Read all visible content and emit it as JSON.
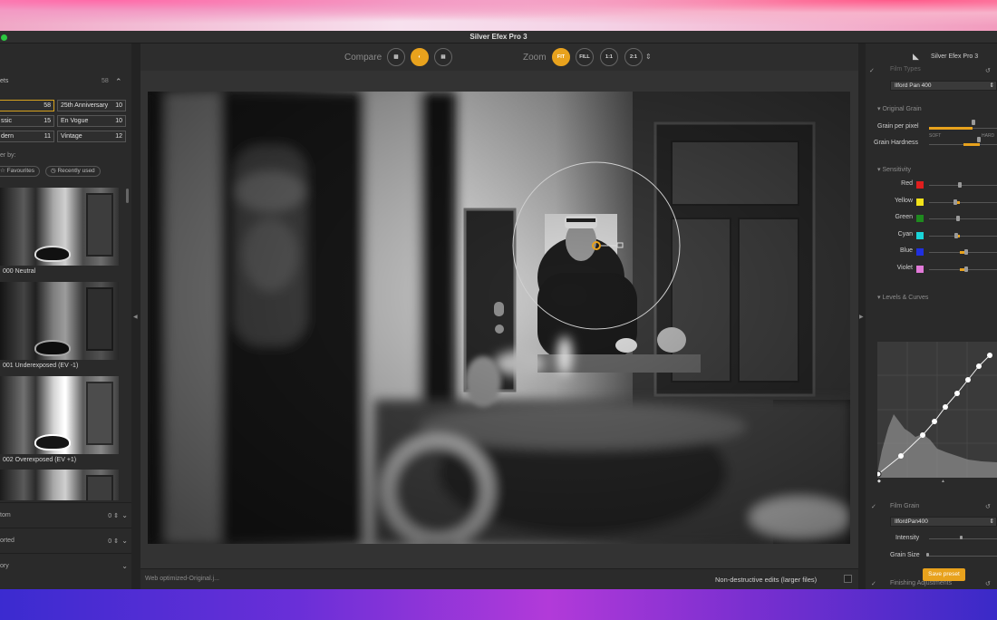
{
  "window": {
    "title": "Silver Efex Pro 3"
  },
  "left_panel": {
    "header": "ets",
    "header_count": "58",
    "presets": [
      {
        "label": "",
        "count": "58",
        "active": true
      },
      {
        "label": "25th Anniversary",
        "count": "10"
      },
      {
        "label": "ssic",
        "count": "15"
      },
      {
        "label": "En Vogue",
        "count": "10"
      },
      {
        "label": "dern",
        "count": "11"
      },
      {
        "label": "Vintage",
        "count": "12"
      }
    ],
    "filter_label": "er by:",
    "filter_favourites": "Favourites",
    "filter_recent": "Recently used",
    "thumbnails": [
      {
        "label": "000 Neutral"
      },
      {
        "label": "001 Underexposed (EV -1)"
      },
      {
        "label": "002 Overexposed (EV +1)"
      }
    ],
    "sections": [
      {
        "label": "tom",
        "right": "0 ⇕"
      },
      {
        "label": "orted",
        "right": "0 ⇕"
      },
      {
        "label": "ory",
        "right": ""
      }
    ]
  },
  "toolbar": {
    "compare_label": "Compare",
    "zoom_label": "Zoom",
    "zoom_fit": "FIT",
    "zoom_fill": "FILL",
    "zoom_1_1": "1:1",
    "zoom_2_1": "2:1"
  },
  "bottom_bar": {
    "filename": "Web optimized-Original.j...",
    "nondestructive": "Non-destructive edits (larger files)"
  },
  "right_panel": {
    "brand": "Silver Efex Pro 3",
    "film_types_label": "Film Types",
    "film_dropdown": "Ilford Pan 400",
    "original_grain_label": "Original Grain",
    "grain_per_pixel": "Grain per pixel",
    "grain_soft": "SOFT",
    "grain_hard": "HARD",
    "grain_hardness": "Grain Hardness",
    "sensitivity_label": "Sensitivity",
    "colors": [
      {
        "label": "Red",
        "color": "#e01e1e",
        "value": 0.45
      },
      {
        "label": "Yellow",
        "color": "#f2e21a",
        "value": 0.38
      },
      {
        "label": "Green",
        "color": "#1f8a1f",
        "value": 0.42
      },
      {
        "label": "Cyan",
        "color": "#19d4d8",
        "value": 0.4
      },
      {
        "label": "Blue",
        "color": "#2030e0",
        "value": 0.55
      },
      {
        "label": "Violet",
        "color": "#e27ad8",
        "value": 0.55
      }
    ],
    "levels_curves_label": "Levels & Curves",
    "film_grain_label": "Film Grain",
    "film_grain_dropdown": "IlfordPan400",
    "intensity_label": "Intensity",
    "grain_size_label": "Grain Size",
    "finishing_label": "Finishing Adjustments",
    "save_preset": "Save preset",
    "accent": "#e8a21d"
  }
}
